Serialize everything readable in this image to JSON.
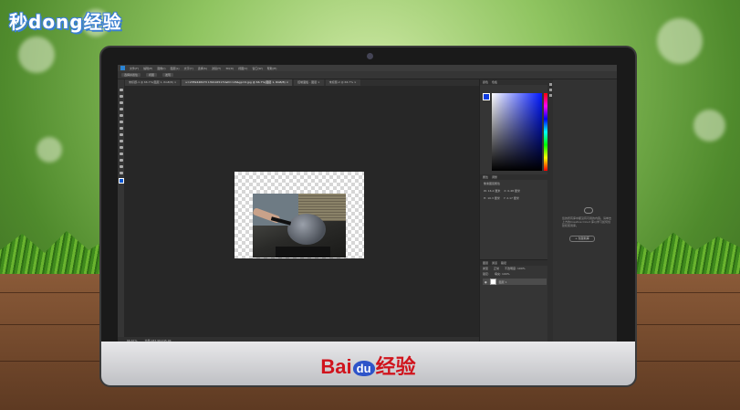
{
  "watermark_top": "秒dong经验",
  "monitor_brand": {
    "bai": "Bai",
    "du": "du",
    "jingyan": "经验"
  },
  "ps": {
    "menus": [
      "文件(F)",
      "编辑(E)",
      "图像(I)",
      "图层(L)",
      "文字(Y)",
      "选择(S)",
      "滤镜(T)",
      "3D(D)",
      "视图(V)",
      "窗口(W)",
      "帮助(H)"
    ],
    "options": [
      "选择并遮住",
      "视图",
      "发现"
    ],
    "tabs": [
      {
        "label": "未标题-1 @ 66.7%(图层 1, RGB/8) ×"
      },
      {
        "label": "u=2359448473 1391165171&fm=26&gp=0.jpg @ 66.7%(图层 1, RGB/8) ×"
      },
      {
        "label": "控制面板 - 图层 ×"
      },
      {
        "label": "未标题-2 @ 66.7% ×"
      }
    ],
    "status_zoom": "66.67%",
    "status_doc": "文档:183.9K/245.9K",
    "color_tabs": [
      "颜色",
      "色板"
    ],
    "props_tabs": [
      "属性",
      "调整"
    ],
    "props_title": "像素图层属性",
    "props_rows": [
      [
        "W: 16.2 厘米",
        "X: 0.48 厘米"
      ],
      [
        "H: 10.3 厘米",
        "Y: 2.17 厘米"
      ]
    ],
    "layers_tabs": [
      "图层",
      "通道",
      "路径"
    ],
    "layers_kind": "类型",
    "layers_mode": "正常",
    "layers_opacity": "不透明度: 100%",
    "layers_lock": "锁定:",
    "layers_fill": "填充: 100%",
    "layer_name": "图层 1",
    "lib_text": "您的所有库中都没有可用的内容。请单击上方的Creative Cloud 库以学习如何创建和使用库。",
    "lib_button": "+ 创建新库"
  }
}
